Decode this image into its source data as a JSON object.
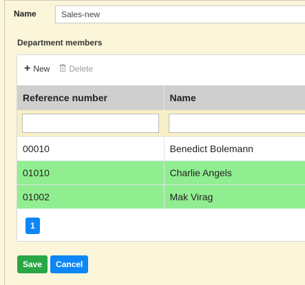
{
  "form": {
    "name_label": "Name",
    "name_value": "Sales-new",
    "section_label": "Department members"
  },
  "toolbar": {
    "new_label": "New",
    "delete_label": "Delete"
  },
  "grid": {
    "columns": [
      "Reference number",
      "Name"
    ],
    "rows": [
      {
        "ref": "00010",
        "name": "Benedict Bolemann",
        "selected": false
      },
      {
        "ref": "01010",
        "name": "Charlie Angels",
        "selected": true
      },
      {
        "ref": "01002",
        "name": "Mak Virag",
        "selected": true
      }
    ],
    "selected_color": "#90ee90"
  },
  "pager": {
    "current_page": "1"
  },
  "actions": {
    "save_label": "Save",
    "cancel_label": "Cancel"
  },
  "colors": {
    "background": "#fbf6d9",
    "save": "#28a745",
    "primary": "#0d87f5"
  }
}
